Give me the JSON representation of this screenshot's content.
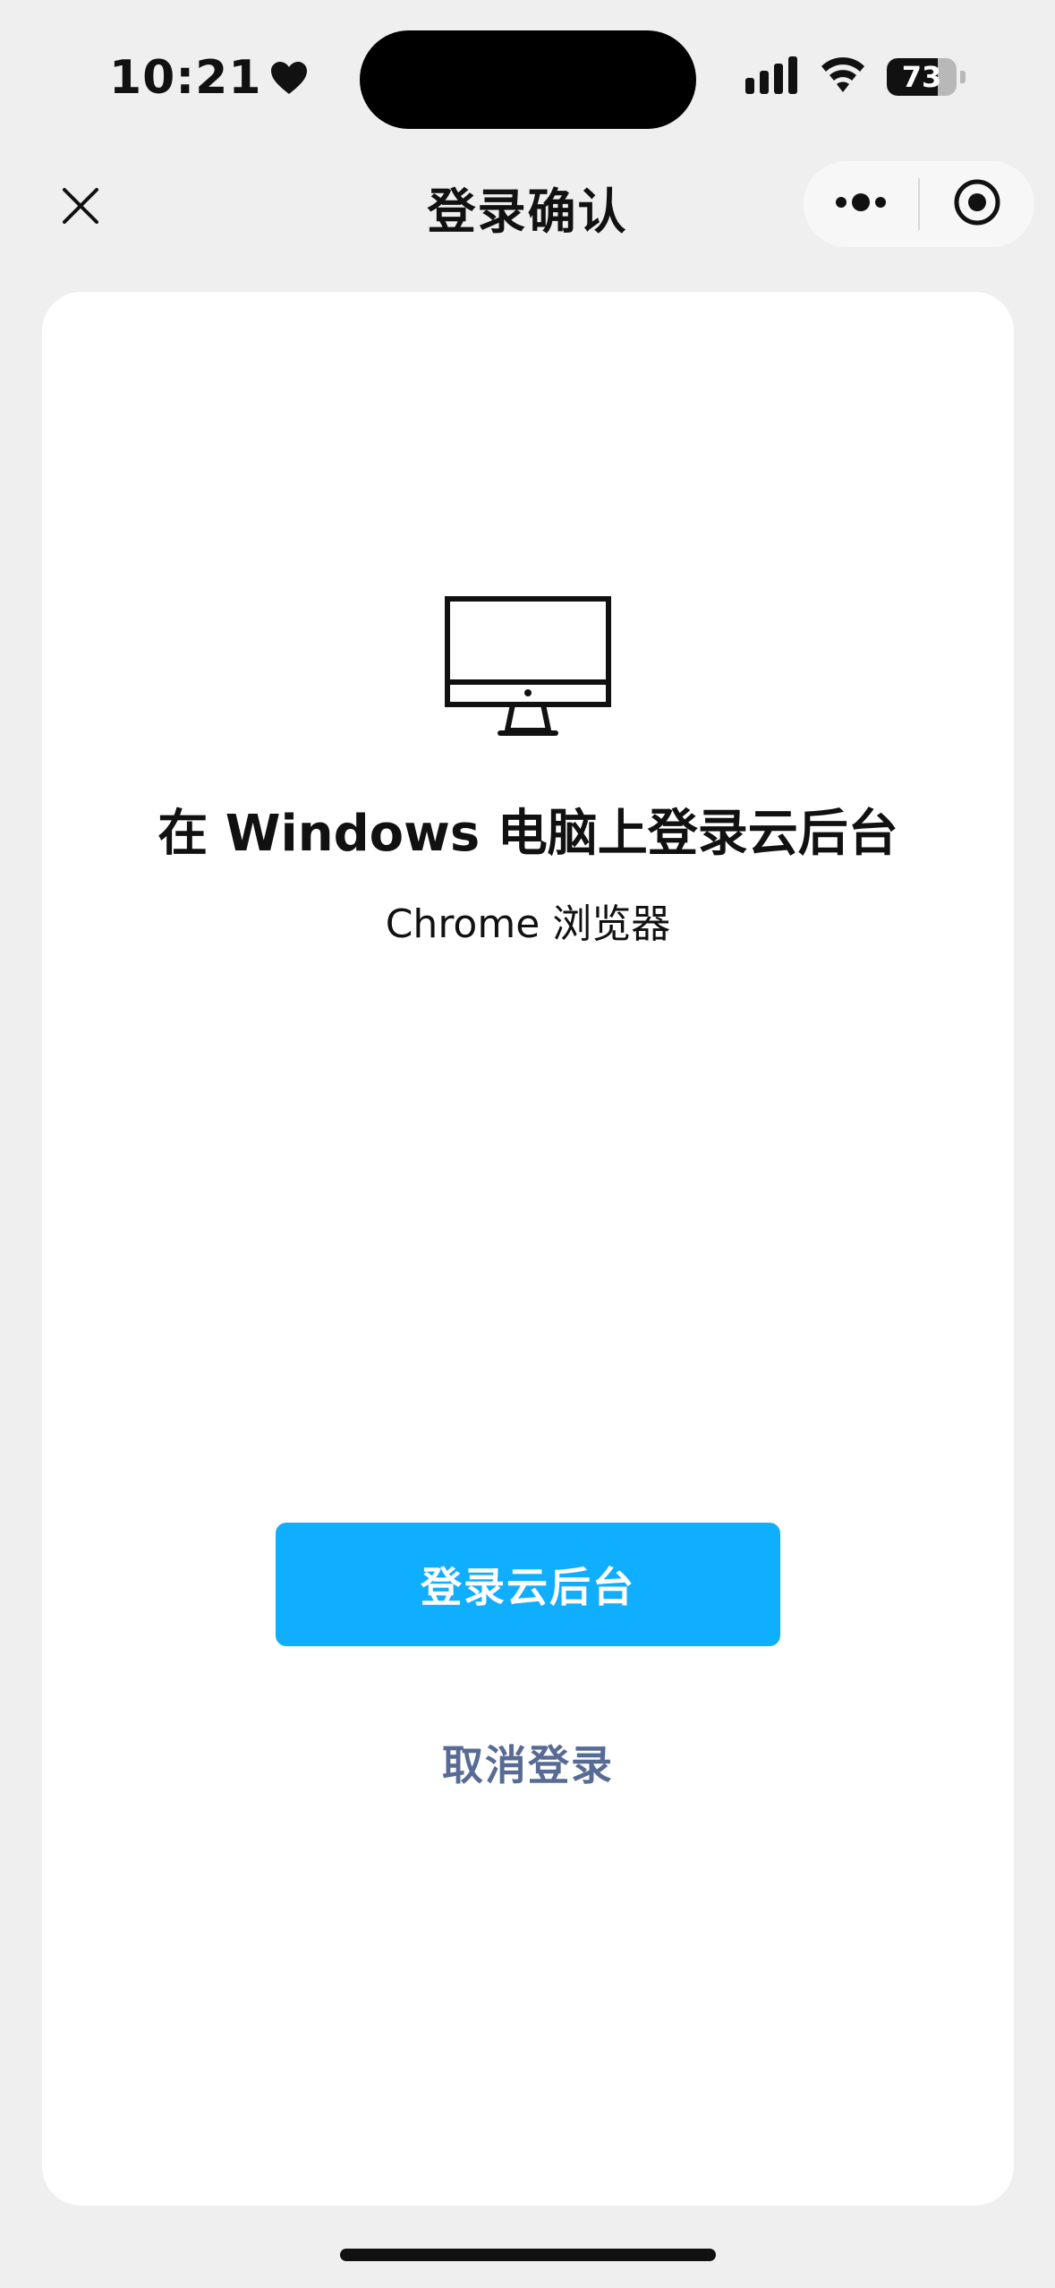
{
  "status_bar": {
    "time": "10:21",
    "heart_icon": "heart-icon",
    "signal_icon": "cellular-signal-icon",
    "wifi_icon": "wifi-icon",
    "battery_level": "73",
    "battery_fraction": 0.73
  },
  "nav": {
    "title": "登录确认",
    "close_icon": "close-icon",
    "more_icon": "more-dots-icon",
    "target_icon": "target-circle-icon"
  },
  "content": {
    "device_icon": "desktop-monitor-icon",
    "device_title": "在 Windows 电脑上登录云后台",
    "browser_name": "Chrome 浏览器",
    "confirm_label": "登录云后台",
    "cancel_label": "取消登录"
  },
  "colors": {
    "page_background": "#efefef",
    "card_background": "#ffffff",
    "primary_button": "#10aeff",
    "cancel_link": "#576b95"
  }
}
